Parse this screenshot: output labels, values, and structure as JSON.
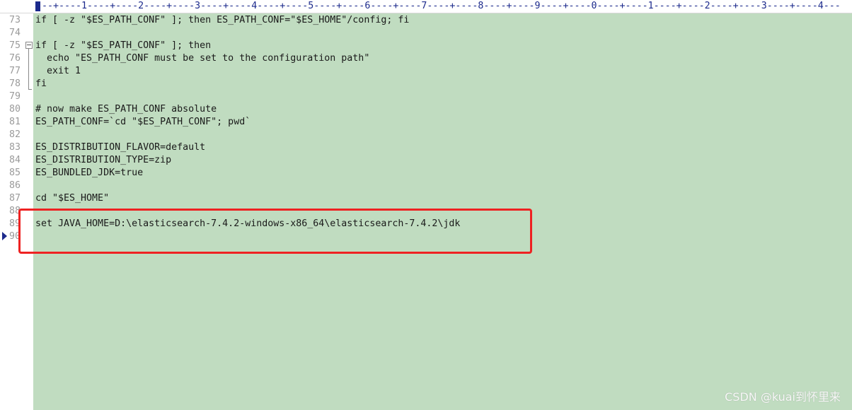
{
  "ruler": {
    "text": "---+----1----+----2----+----3----+----4----+----5----+----6----+----7----+----8----+----9----+----0----+----1----+----2----+----3----+----4---"
  },
  "lines": [
    {
      "number": "73",
      "text": "if [ -z \"$ES_PATH_CONF\" ]; then ES_PATH_CONF=\"$ES_HOME\"/config; fi"
    },
    {
      "number": "74",
      "text": ""
    },
    {
      "number": "75",
      "text": "if [ -z \"$ES_PATH_CONF\" ]; then"
    },
    {
      "number": "76",
      "text": "  echo \"ES_PATH_CONF must be set to the configuration path\""
    },
    {
      "number": "77",
      "text": "  exit 1"
    },
    {
      "number": "78",
      "text": "fi"
    },
    {
      "number": "79",
      "text": ""
    },
    {
      "number": "80",
      "text": "# now make ES_PATH_CONF absolute"
    },
    {
      "number": "81",
      "text": "ES_PATH_CONF=`cd \"$ES_PATH_CONF\"; pwd`"
    },
    {
      "number": "82",
      "text": ""
    },
    {
      "number": "83",
      "text": "ES_DISTRIBUTION_FLAVOR=default"
    },
    {
      "number": "84",
      "text": "ES_DISTRIBUTION_TYPE=zip"
    },
    {
      "number": "85",
      "text": "ES_BUNDLED_JDK=true"
    },
    {
      "number": "86",
      "text": ""
    },
    {
      "number": "87",
      "text": "cd \"$ES_HOME\""
    },
    {
      "number": "88",
      "text": ""
    },
    {
      "number": "89",
      "text": "set JAVA_HOME=D:\\elasticsearch-7.4.2-windows-x86_64\\elasticsearch-7.4.2\\jdk"
    },
    {
      "number": "90",
      "text": ""
    }
  ],
  "watermark": "CSDN @kuai到怀里来",
  "colors": {
    "code_background": "#c0dcc0",
    "highlight_border": "#ee2222",
    "ruler_text": "#1c2a8c",
    "line_number": "#9a9a9a"
  },
  "icons": {
    "fold": "fold-minus-icon",
    "bookmark": "current-line-arrow-icon"
  }
}
